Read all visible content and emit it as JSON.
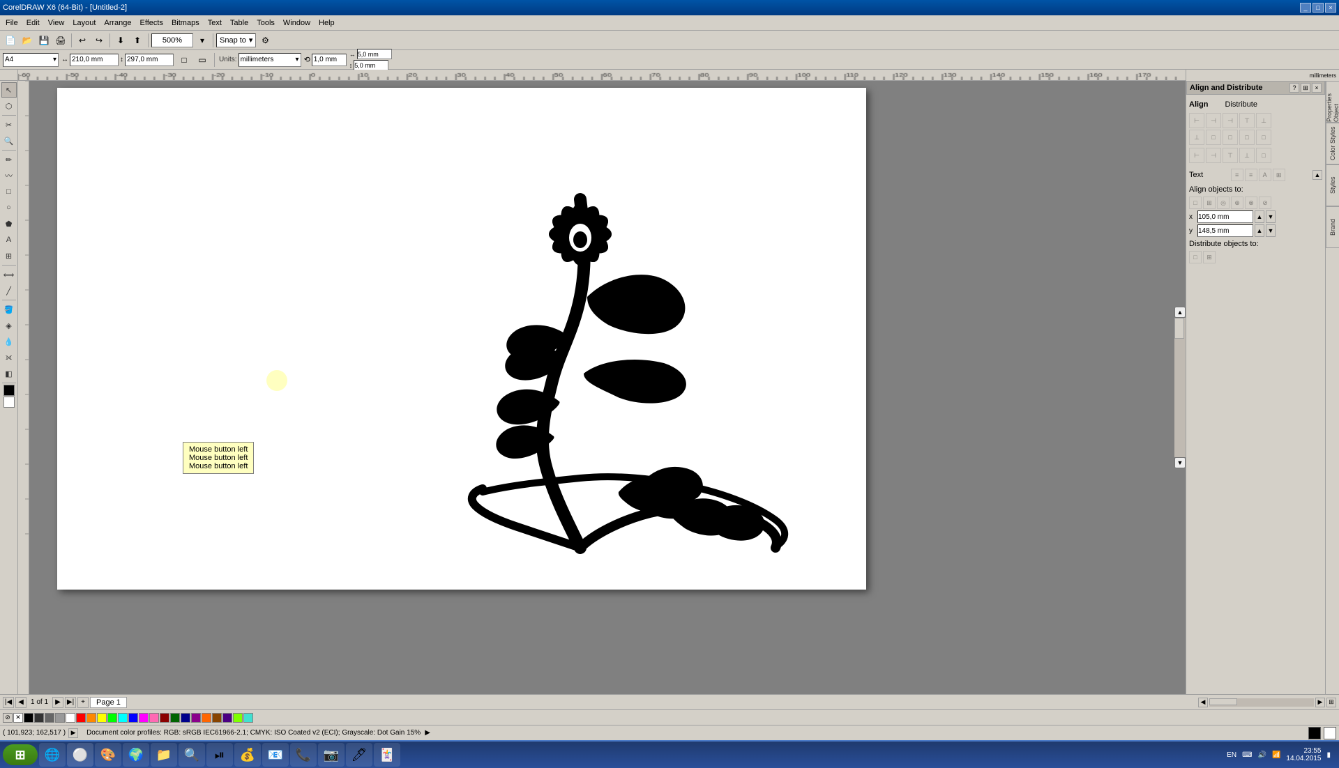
{
  "titleBar": {
    "title": "CorelDRAW X6 (64-Bit) - [Untitled-2]",
    "controls": [
      "_",
      "□",
      "×"
    ]
  },
  "menuBar": {
    "items": [
      "File",
      "Edit",
      "View",
      "Layout",
      "Arrange",
      "Effects",
      "Bitmaps",
      "Text",
      "Table",
      "Tools",
      "Window",
      "Help"
    ]
  },
  "toolbar": {
    "zoom": "500%",
    "snapTo": "Snap to",
    "snapIcon": "▾"
  },
  "propertyBar": {
    "paperSize": "A4",
    "width": "210,0 mm",
    "height": "297,0 mm",
    "units": "millimeters",
    "nudge": "1,0 mm",
    "hStep": "5,0 mm",
    "vStep": "5,0 mm"
  },
  "alignPanel": {
    "title": "Align and Distribute",
    "alignLabel": "Align",
    "distributeLabel": "Distribute",
    "textLabel": "Text",
    "alignObjectsToLabel": "Align objects to:",
    "xCoord": "105,0 mm",
    "yCoord": "148,5 mm",
    "distributeObjectsToLabel": "Distribute objects to:"
  },
  "sideTabs": [
    "Object Properties",
    "Styles",
    "Color Styles",
    "Brand"
  ],
  "canvas": {
    "pageWidth": 760,
    "pageHeight": 600,
    "pageLeft": 40,
    "pageTop": 10
  },
  "tooltip": {
    "line1": "Mouse button left",
    "line2": "Mouse button left",
    "line3": "Mouse button left"
  },
  "pageNav": {
    "current": "1",
    "total": "1",
    "label": "Page 1"
  },
  "statusBar": {
    "coordinates": "( 101,923; 162,517 )",
    "colorProfile": "Document color profiles: RGB: sRGB IEC61966-2.1; CMYK: ISO Coated v2 (ECI); Grayscale: Dot Gain 15%"
  },
  "colorPalette": {
    "colors": [
      "#ffffff",
      "#000000",
      "#ff0000",
      "#00aa00",
      "#0000ff",
      "#ffff00",
      "#ff00ff",
      "#00ffff",
      "#ff8800",
      "#8800ff",
      "#ff0088",
      "#00ff88",
      "#888888",
      "#cccccc",
      "#884400",
      "#004488",
      "#880044",
      "#448800",
      "#cc4400",
      "#4400cc"
    ]
  },
  "taskbar": {
    "startLabel": "Start",
    "apps": [
      "🌐",
      "🎨",
      "📁",
      "🌍",
      "📂",
      "🔍",
      "🎮",
      "⏯",
      "💰",
      "📧",
      "📞",
      "🔧",
      "🎯",
      "🃏"
    ],
    "time": "23:55",
    "date": "14.04.2015",
    "language": "EN"
  }
}
